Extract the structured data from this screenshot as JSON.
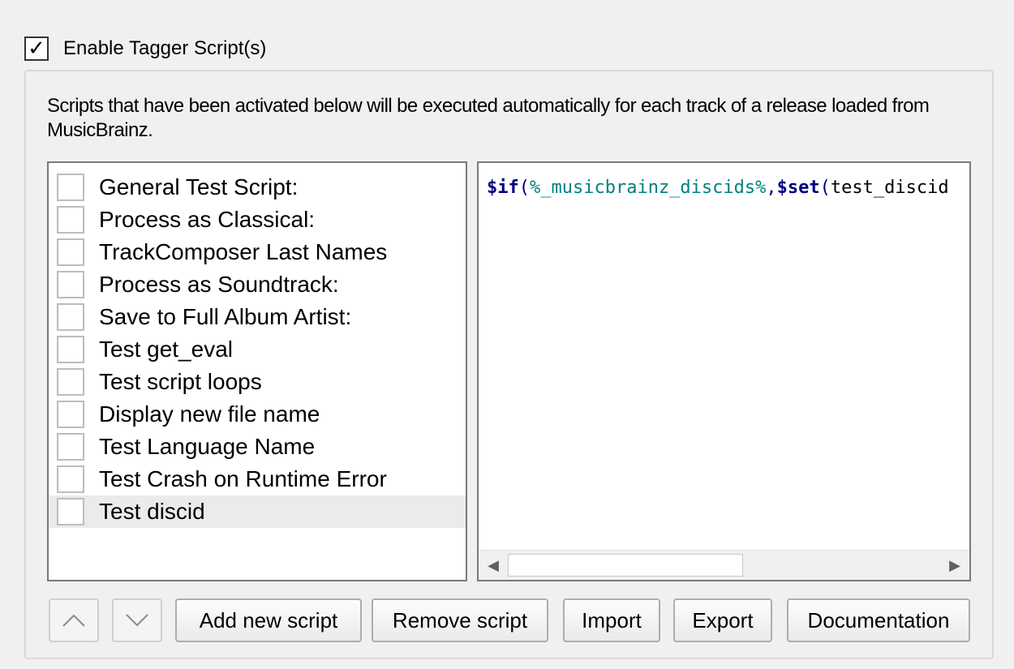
{
  "enable": {
    "label": "Enable Tagger Script(s)",
    "checked": true,
    "check_mark": "✓"
  },
  "description": "Scripts that have been activated below will be executed automatically for each track of a release loaded from MusicBrainz.",
  "scripts": [
    {
      "label": "General Test Script:",
      "checked": false
    },
    {
      "label": "Process as Classical:",
      "checked": false
    },
    {
      "label": "TrackComposer Last Names",
      "checked": false
    },
    {
      "label": "Process as Soundtrack:",
      "checked": false
    },
    {
      "label": "Save to Full Album Artist:",
      "checked": false
    },
    {
      "label": "Test get_eval",
      "checked": false
    },
    {
      "label": "Test script loops",
      "checked": false
    },
    {
      "label": "Display new file name",
      "checked": false
    },
    {
      "label": "Test Language Name",
      "checked": false
    },
    {
      "label": "Test Crash on Runtime Error",
      "checked": false
    },
    {
      "label": "Test discid",
      "checked": false,
      "selected": true
    }
  ],
  "editor": {
    "tokens": [
      {
        "text": "$if",
        "kind": "fn"
      },
      {
        "text": "(",
        "kind": "punct"
      },
      {
        "text": "%_musicbrainz_discids%",
        "kind": "var"
      },
      {
        "text": ",",
        "kind": "punct"
      },
      {
        "text": "$set",
        "kind": "fn"
      },
      {
        "text": "(",
        "kind": "punct"
      },
      {
        "text": "test_discid",
        "kind": "plain"
      }
    ],
    "scroll_left_icon": "arrow-left-icon",
    "scroll_right_icon": "arrow-right-icon"
  },
  "buttons": {
    "move_up_icon": "chevron-up-icon",
    "move_down_icon": "chevron-down-icon",
    "add_new_script": "Add new script",
    "remove_script": "Remove script",
    "import": "Import",
    "export": "Export",
    "documentation": "Documentation"
  }
}
